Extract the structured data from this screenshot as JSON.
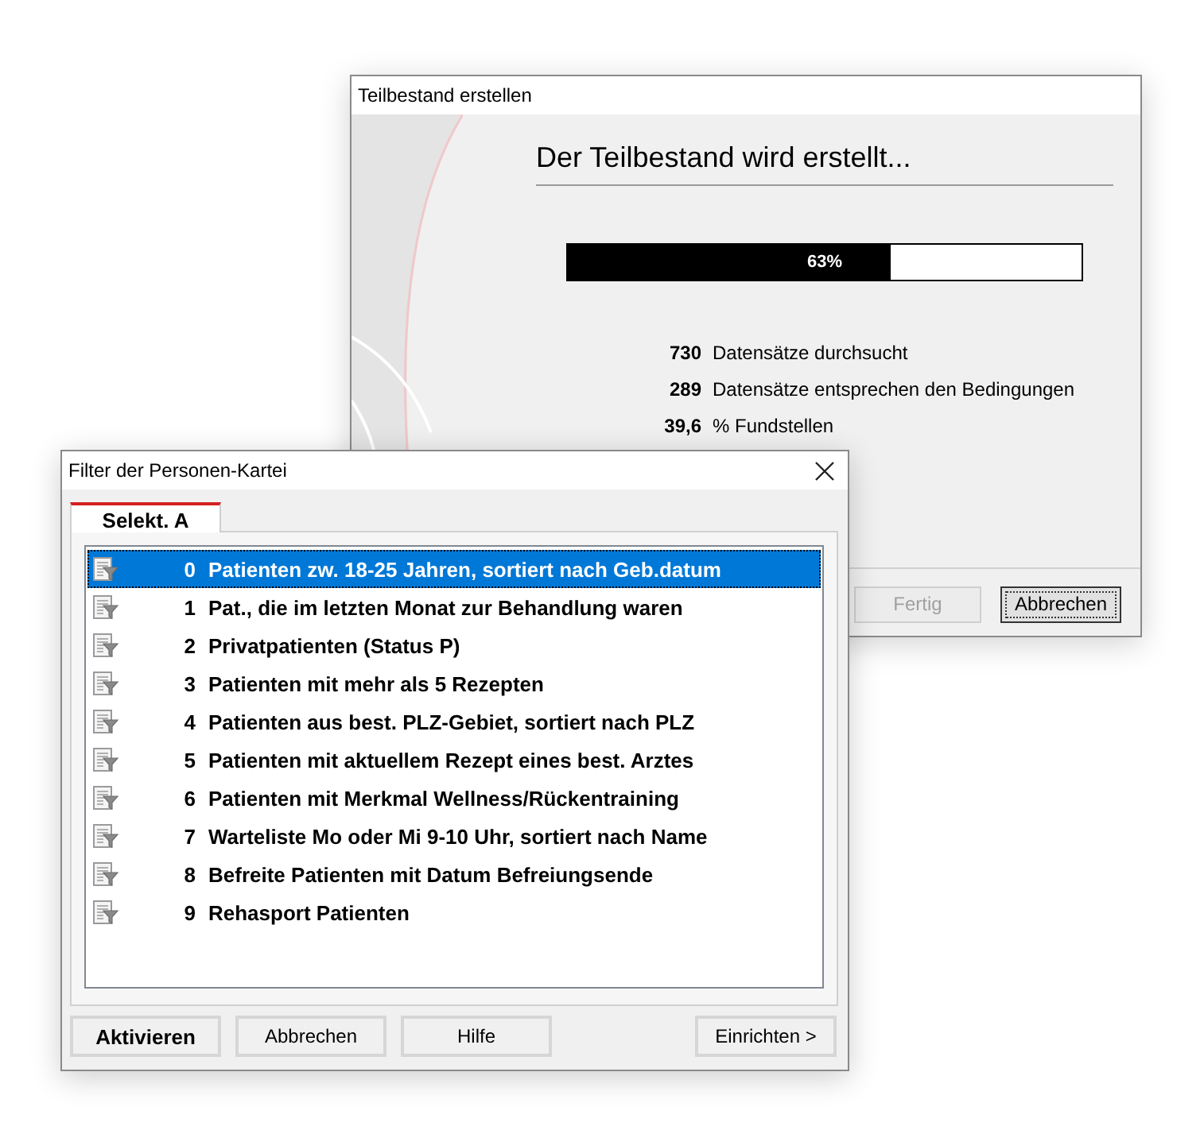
{
  "progress_dialog": {
    "title": "Teilbestand erstellen",
    "heading": "Der Teilbestand wird erstellt...",
    "progress": {
      "level": 0.63,
      "label": "63%"
    },
    "stats": [
      {
        "value": "730",
        "label": "Datensätze durchsucht"
      },
      {
        "value": "289",
        "label": "Datensätze entsprechen den Bedingungen"
      },
      {
        "value": "39,6",
        "label": "% Fundstellen"
      }
    ],
    "buttons": [
      {
        "label": "Fertig",
        "disabled": true,
        "focused": false
      },
      {
        "label": "Abbrechen",
        "disabled": false,
        "focused": true
      }
    ]
  },
  "filter_dialog": {
    "title": "Filter der Personen-Kartei",
    "tabs": [
      {
        "label": "Selekt. A",
        "selected": true
      }
    ],
    "filters": [
      {
        "number": "0",
        "label": "Patienten zw. 18-25 Jahren, sortiert nach Geb.datum",
        "selected": true
      },
      {
        "number": "1",
        "label": "Pat., die im letzten Monat zur Behandlung waren",
        "selected": false
      },
      {
        "number": "2",
        "label": "Privatpatienten (Status P)",
        "selected": false
      },
      {
        "number": "3",
        "label": "Patienten mit mehr als 5 Rezepten",
        "selected": false
      },
      {
        "number": "4",
        "label": "Patienten aus best. PLZ-Gebiet, sortiert nach PLZ",
        "selected": false
      },
      {
        "number": "5",
        "label": "Patienten mit aktuellem Rezept eines best. Arztes",
        "selected": false
      },
      {
        "number": "6",
        "label": "Patienten mit Merkmal Wellness/Rückentraining",
        "selected": false
      },
      {
        "number": "7",
        "label": "Warteliste Mo oder Mi 9-10 Uhr, sortiert nach Name",
        "selected": false
      },
      {
        "number": "8",
        "label": "Befreite Patienten mit Datum Befreiungsende",
        "selected": false
      },
      {
        "number": "9",
        "label": "Rehasport Patienten",
        "selected": false
      }
    ],
    "buttons": [
      {
        "label": "Aktivieren",
        "bold": true
      },
      {
        "label": "Abbrechen",
        "bold": false
      },
      {
        "label": "Hilfe",
        "bold": false
      },
      {
        "label": "Einrichten >",
        "bold": false
      }
    ]
  }
}
